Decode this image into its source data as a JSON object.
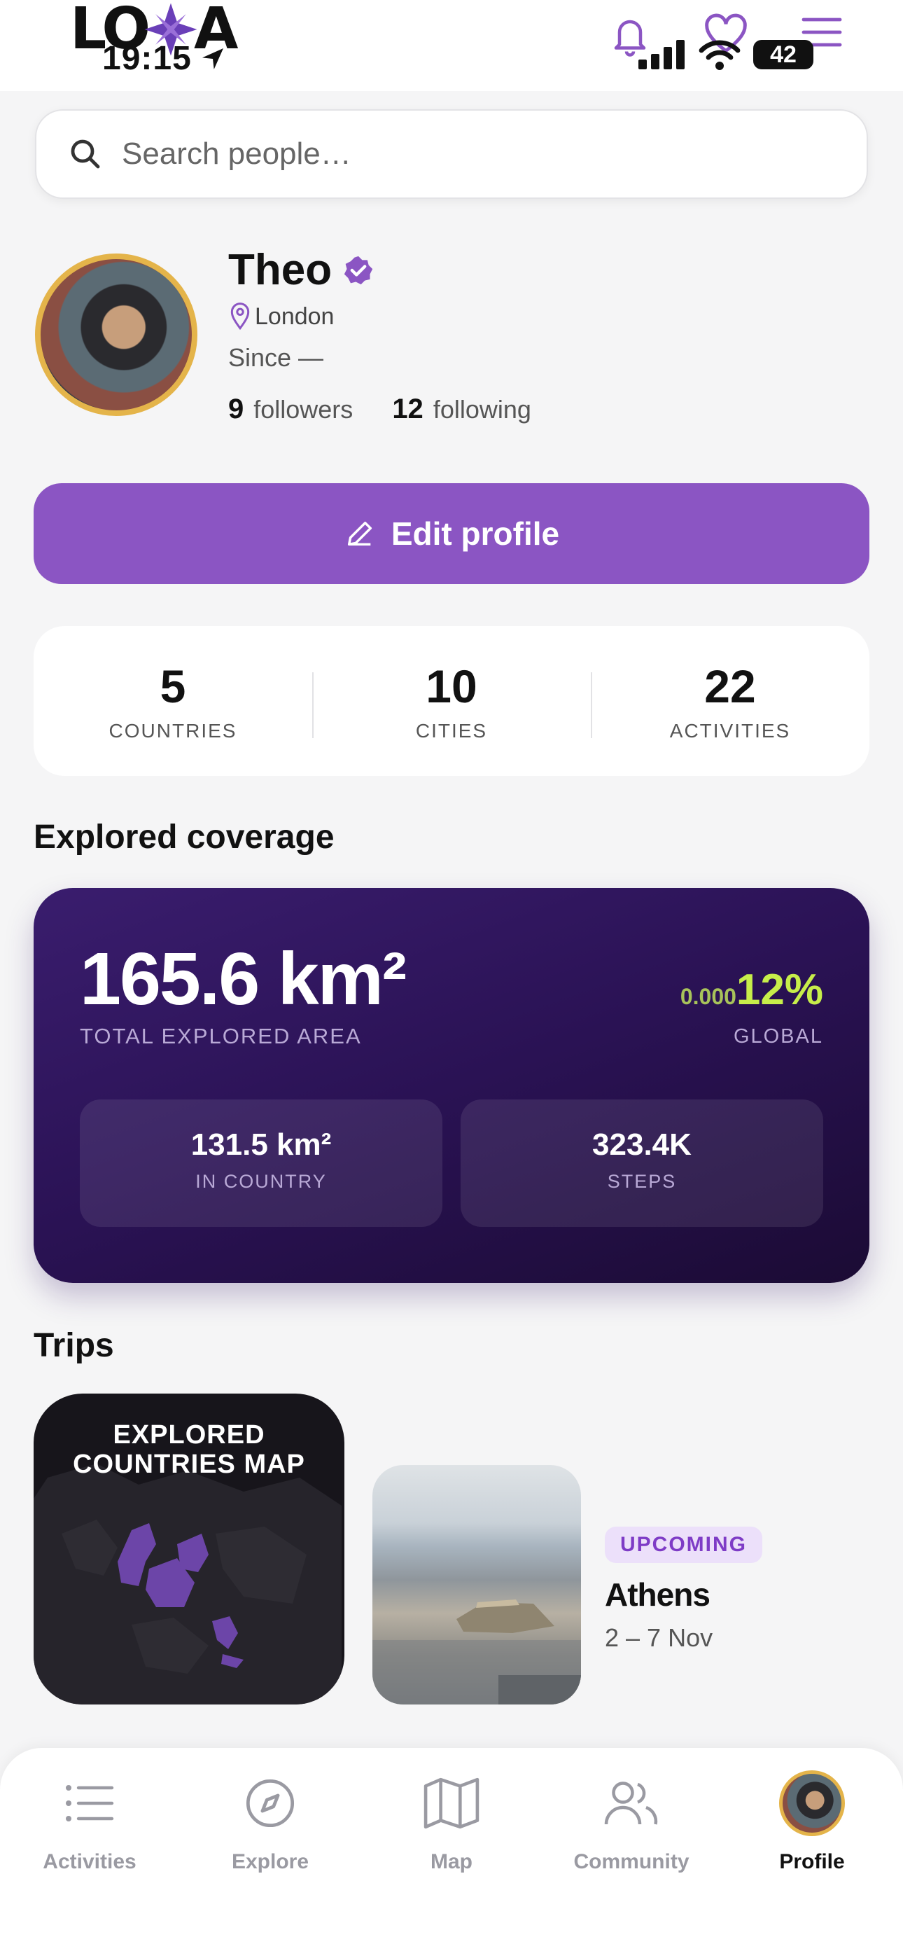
{
  "app": {
    "logo_text": "LOXA"
  },
  "status_bar": {
    "time": "19:15",
    "battery": "42"
  },
  "search": {
    "placeholder": "Search people…"
  },
  "profile": {
    "name": "Theo",
    "location": "London",
    "since": "Since —",
    "followers_count": "9",
    "followers_label": "followers",
    "following_count": "12",
    "following_label": "following",
    "edit_label": "Edit profile"
  },
  "stats": [
    {
      "value": "5",
      "label": "COUNTRIES"
    },
    {
      "value": "10",
      "label": "CITIES"
    },
    {
      "value": "22",
      "label": "ACTIVITIES"
    }
  ],
  "coverage": {
    "title": "Explored coverage",
    "total_area": "165.6 km²",
    "total_area_label": "TOTAL EXPLORED AREA",
    "global_prefix": "0.000",
    "global_value": "12%",
    "global_label": "GLOBAL",
    "in_country_value": "131.5 km²",
    "in_country_label": "IN COUNTRY",
    "steps_value": "323.4K",
    "steps_label": "STEPS"
  },
  "trips": {
    "title": "Trips",
    "map_card_line1": "EXPLORED",
    "map_card_line2": "COUNTRIES MAP",
    "trip": {
      "badge": "UPCOMING",
      "name": "Athens",
      "dates": "2 – 7 Nov"
    }
  },
  "nav": [
    {
      "label": "Activities",
      "icon": "list-icon"
    },
    {
      "label": "Explore",
      "icon": "compass-icon"
    },
    {
      "label": "Map",
      "icon": "map-icon"
    },
    {
      "label": "Community",
      "icon": "users-icon"
    },
    {
      "label": "Profile",
      "icon": "avatar"
    }
  ],
  "colors": {
    "accent": "#8b55c3",
    "coverage_bg": "#2a1254",
    "highlight": "#c7ee4a",
    "badge_bg": "#ece0fa",
    "gold": "#e4b44a"
  }
}
